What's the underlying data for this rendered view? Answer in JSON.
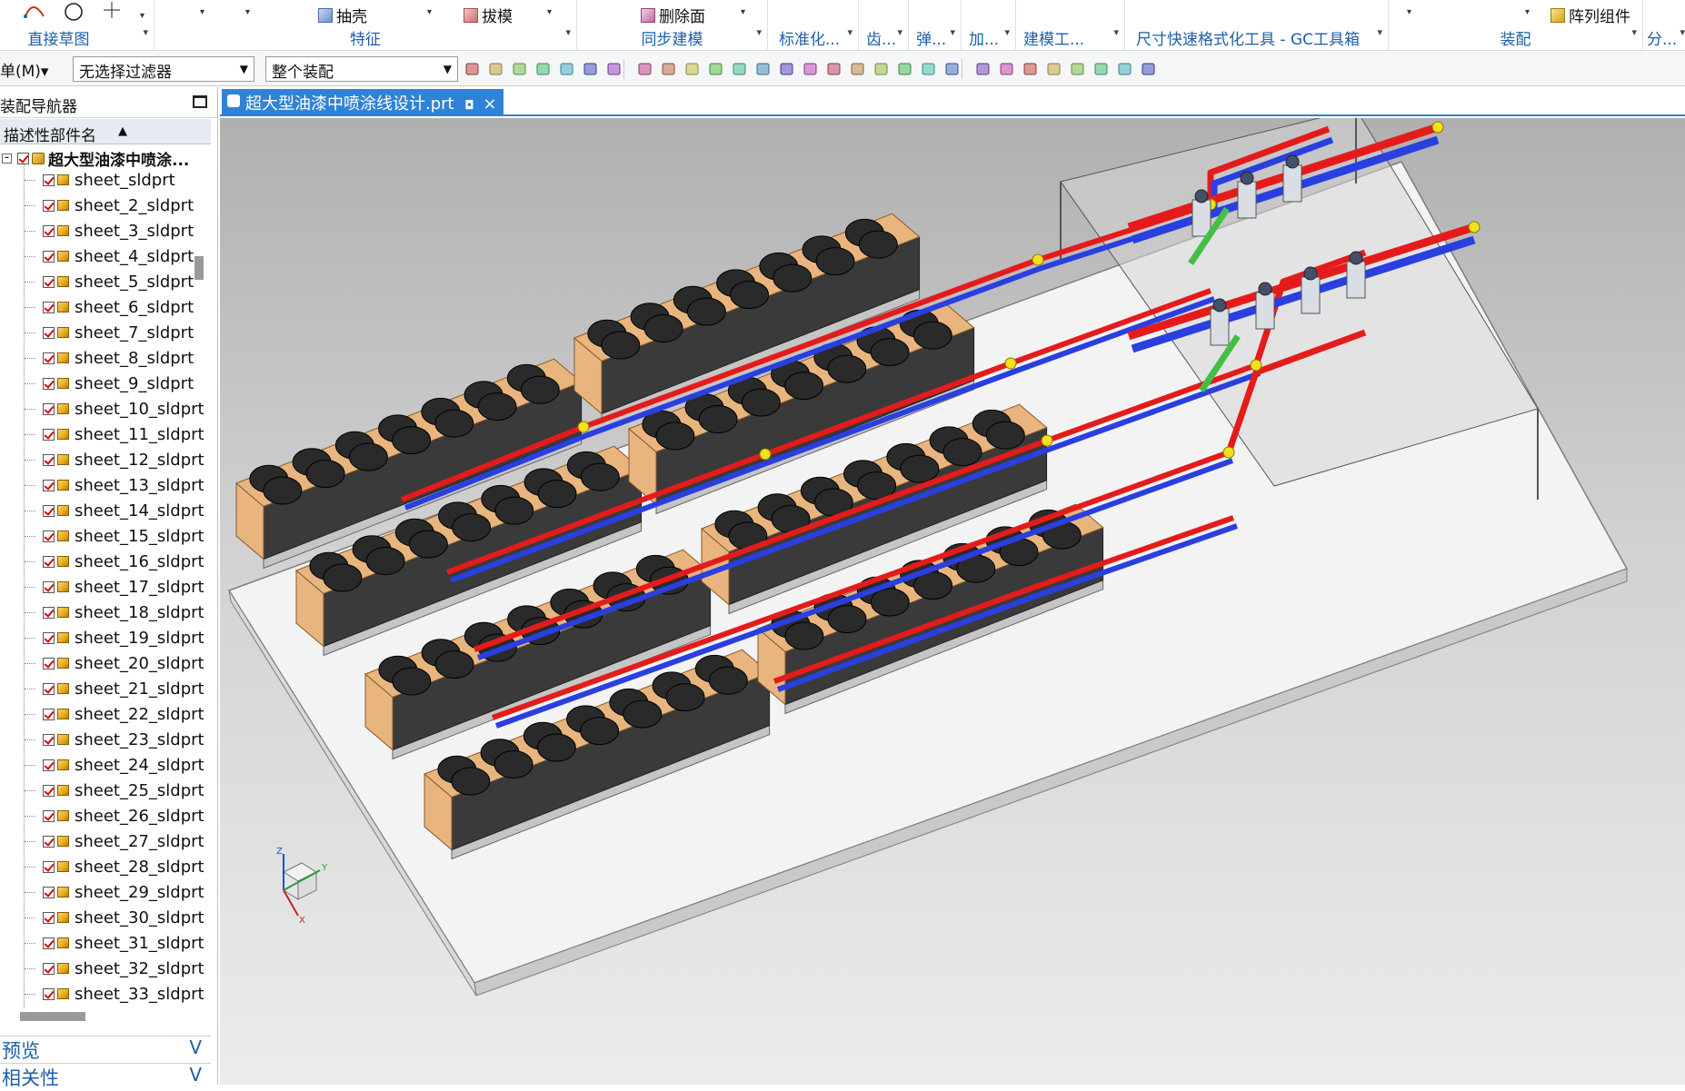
{
  "ribbon": {
    "groups": [
      {
        "label": "直接草图",
        "dropdown": "▾"
      },
      {
        "label": "特征",
        "dropdown": "▾"
      },
      {
        "label": "同步建模",
        "dropdown": "▾"
      },
      {
        "label": "标准化...",
        "dropdown": "▾"
      },
      {
        "label": "齿...",
        "dropdown": "▾"
      },
      {
        "label": "弹...",
        "dropdown": "▾"
      },
      {
        "label": "加...",
        "dropdown": "▾"
      },
      {
        "label": "建模工...",
        "dropdown": "▾"
      },
      {
        "label": "尺寸快速格式化工具 - GC工具箱",
        "dropdown": "▾"
      },
      {
        "label": "装配",
        "dropdown": "▾"
      },
      {
        "label": "分...",
        "dropdown": "▾"
      }
    ],
    "buttons": {
      "shell": "抽壳",
      "draft": "拔模",
      "delete_face": "删除面",
      "pattern_component": "阵列组件"
    }
  },
  "toolbar": {
    "menu": "菜单(M)▾",
    "menu_visible": "单(M)▾",
    "filter_value": "无选择过滤器",
    "scope_value": "整个装配"
  },
  "navigator": {
    "title": "装配导航器",
    "column_header": "描述性部件名",
    "root_label": "超大型油漆中喷涂...",
    "parts": [
      "sheet_sldprt",
      "sheet_2_sldprt",
      "sheet_3_sldprt",
      "sheet_4_sldprt",
      "sheet_5_sldprt",
      "sheet_6_sldprt",
      "sheet_7_sldprt",
      "sheet_8_sldprt",
      "sheet_9_sldprt",
      "sheet_10_sldprt",
      "sheet_11_sldprt",
      "sheet_12_sldprt",
      "sheet_13_sldprt",
      "sheet_14_sldprt",
      "sheet_15_sldprt",
      "sheet_16_sldprt",
      "sheet_17_sldprt",
      "sheet_18_sldprt",
      "sheet_19_sldprt",
      "sheet_20_sldprt",
      "sheet_21_sldprt",
      "sheet_22_sldprt",
      "sheet_23_sldprt",
      "sheet_24_sldprt",
      "sheet_25_sldprt",
      "sheet_26_sldprt",
      "sheet_27_sldprt",
      "sheet_28_sldprt",
      "sheet_29_sldprt",
      "sheet_30_sldprt",
      "sheet_31_sldprt",
      "sheet_32_sldprt",
      "sheet_33_sldprt"
    ],
    "sections": [
      {
        "label": "预览",
        "chevron": "V"
      },
      {
        "label": "相关性",
        "chevron": "V"
      }
    ]
  },
  "graphics": {
    "tab_title": "超大型油漆中喷涂线设计.prt",
    "tab_close": "×",
    "triad_labels": {
      "z": "Z",
      "y": "Y",
      "x": "X"
    }
  },
  "colors": {
    "accent": "#2f83d6",
    "hot_pipe": "#e51b1b",
    "cold_pipe": "#2a3fe0",
    "elbow": "#f3e01e",
    "unit_body": "#e8b57f",
    "fan": "#2a2a2a",
    "slab": "#f2f2f2"
  }
}
